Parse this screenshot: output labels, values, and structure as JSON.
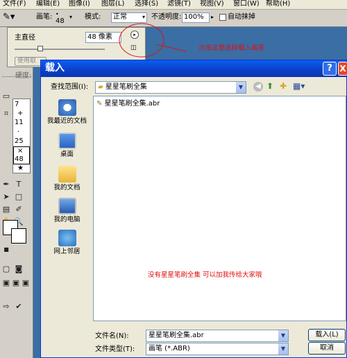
{
  "menubar": {
    "items": [
      "文件(F)",
      "编辑(E)",
      "图像(I)",
      "图层(L)",
      "选择(S)",
      "滤镜(T)",
      "视图(V)",
      "窗口(W)",
      "帮助(H)"
    ]
  },
  "options_bar": {
    "brush_label": "画笔:",
    "brush_size": "48",
    "mode_label": "模式:",
    "mode_value": "正常",
    "opacity_label": "不透明度:",
    "opacity_value": "100%",
    "auto_erase_label": "自动抹掉"
  },
  "brush_panel": {
    "diameter_label": "主直径",
    "diameter_value": "48 像素",
    "use_sample_label": "使用取",
    "hardness_label": "硬度:"
  },
  "brush_presets": [
    "7",
    "+",
    "11",
    "·",
    "25",
    "×",
    "48",
    "★"
  ],
  "annotations": {
    "top": "点击这里选择载入画笔",
    "middle": "没有星星笔刷全集 可以加我传给大家哦"
  },
  "dialog": {
    "title": "载入",
    "help_label": "?",
    "close_label": "X",
    "look_in_label": "查找范围(I):",
    "look_in_value": "星星笔刷全集",
    "places": [
      "我最近的文档",
      "桌面",
      "我的文档",
      "我的电脑",
      "网上邻居"
    ],
    "files": [
      "星星笔刷全集.abr"
    ],
    "filename_label": "文件名(N):",
    "filename_value": "星星笔刷全集.abr",
    "filetype_label": "文件类型(T):",
    "filetype_value": "画笔 (*.ABR)",
    "load_button": "载入(L)",
    "cancel_button": "取消"
  },
  "colors": {
    "accent": "#0a5ef0",
    "annotation": "#e01010",
    "desktop": "#3a6ea5"
  }
}
